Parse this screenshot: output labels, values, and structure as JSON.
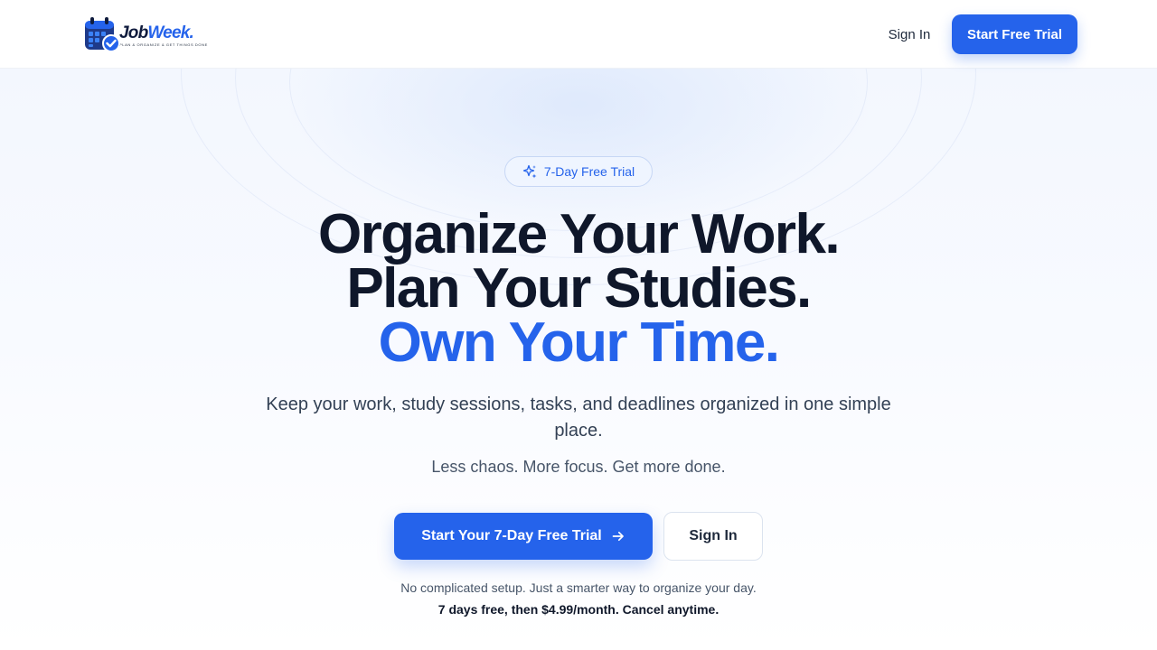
{
  "brand": {
    "name_part1": "Job",
    "name_part2": "Week.",
    "tagline": "Plan & organize & get things done",
    "primary_color": "#2563eb",
    "dark_color": "#0f172a"
  },
  "nav": {
    "sign_in_label": "Sign In",
    "trial_label": "Start Free Trial"
  },
  "hero": {
    "badge_icon": "sparkles-icon",
    "badge_label": "7-Day Free Trial",
    "headline_line1": "Organize Your Work.",
    "headline_line2": "Plan Your Studies.",
    "headline_line3": "Own Your Time.",
    "subtitle": "Keep your work, study sessions, tasks, and deadlines organized in one simple place.",
    "tagline": "Less chaos. More focus. Get more done.",
    "cta_primary_label": "Start Your 7-Day Free Trial",
    "cta_primary_icon": "arrow-right-icon",
    "cta_secondary_label": "Sign In",
    "note_line1": "No complicated setup. Just a smarter way to organize your day.",
    "note_line2": "7 days free, then $4.99/month. Cancel anytime."
  }
}
